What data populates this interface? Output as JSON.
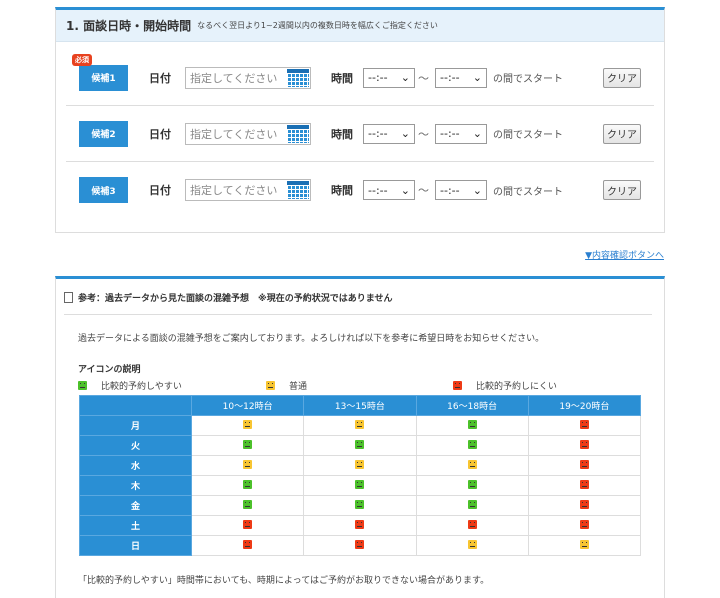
{
  "section1": {
    "title": "1. 面談日時・開始時間",
    "subtitle": "なるべく翌日より1~2週間以内の複数日時を幅広くご指定ください",
    "required_badge": "必須",
    "date_label": "日付",
    "time_label": "時間",
    "date_placeholder": "指定してください",
    "time_value": "--:--",
    "tilde": "～",
    "after": "の間でスタート",
    "clear": "クリア",
    "candidates": [
      {
        "label": "候補1"
      },
      {
        "label": "候補2"
      },
      {
        "label": "候補3"
      }
    ]
  },
  "link": "▼内容確認ボタンへ",
  "section2": {
    "title": "参考：過去データから見た面談の混雑予想　※現在の予約状況ではありません",
    "intro": "過去データによる面談の混雑予想をご案内しております。よろしければ以下を参考に希望日時をお知らせください。",
    "icon_heading": "アイコンの説明",
    "legend": [
      {
        "level": "green",
        "label": "比較的予約しやすい"
      },
      {
        "level": "yellow",
        "label": "普通"
      },
      {
        "level": "red",
        "label": "比較的予約しにくい"
      }
    ],
    "columns": [
      "10～12時台",
      "13～15時台",
      "16～18時台",
      "19～20時台"
    ],
    "rows": [
      {
        "day": "月",
        "levels": [
          "yellow",
          "yellow",
          "green",
          "red"
        ]
      },
      {
        "day": "火",
        "levels": [
          "green",
          "green",
          "green",
          "red"
        ]
      },
      {
        "day": "水",
        "levels": [
          "yellow",
          "yellow",
          "yellow",
          "red"
        ]
      },
      {
        "day": "木",
        "levels": [
          "green",
          "green",
          "green",
          "red"
        ]
      },
      {
        "day": "金",
        "levels": [
          "green",
          "green",
          "green",
          "red"
        ]
      },
      {
        "day": "土",
        "levels": [
          "red",
          "red",
          "red",
          "red"
        ]
      },
      {
        "day": "日",
        "levels": [
          "red",
          "red",
          "yellow",
          "yellow"
        ]
      }
    ],
    "note": "「比較的予約しやすい」時間帯においても、時期によってはご予約がお取りできない場合があります。"
  },
  "colors": {
    "accent": "#2a8fd4",
    "green": "#4cc12a",
    "yellow": "#f8c531",
    "red": "#ee3a16"
  }
}
